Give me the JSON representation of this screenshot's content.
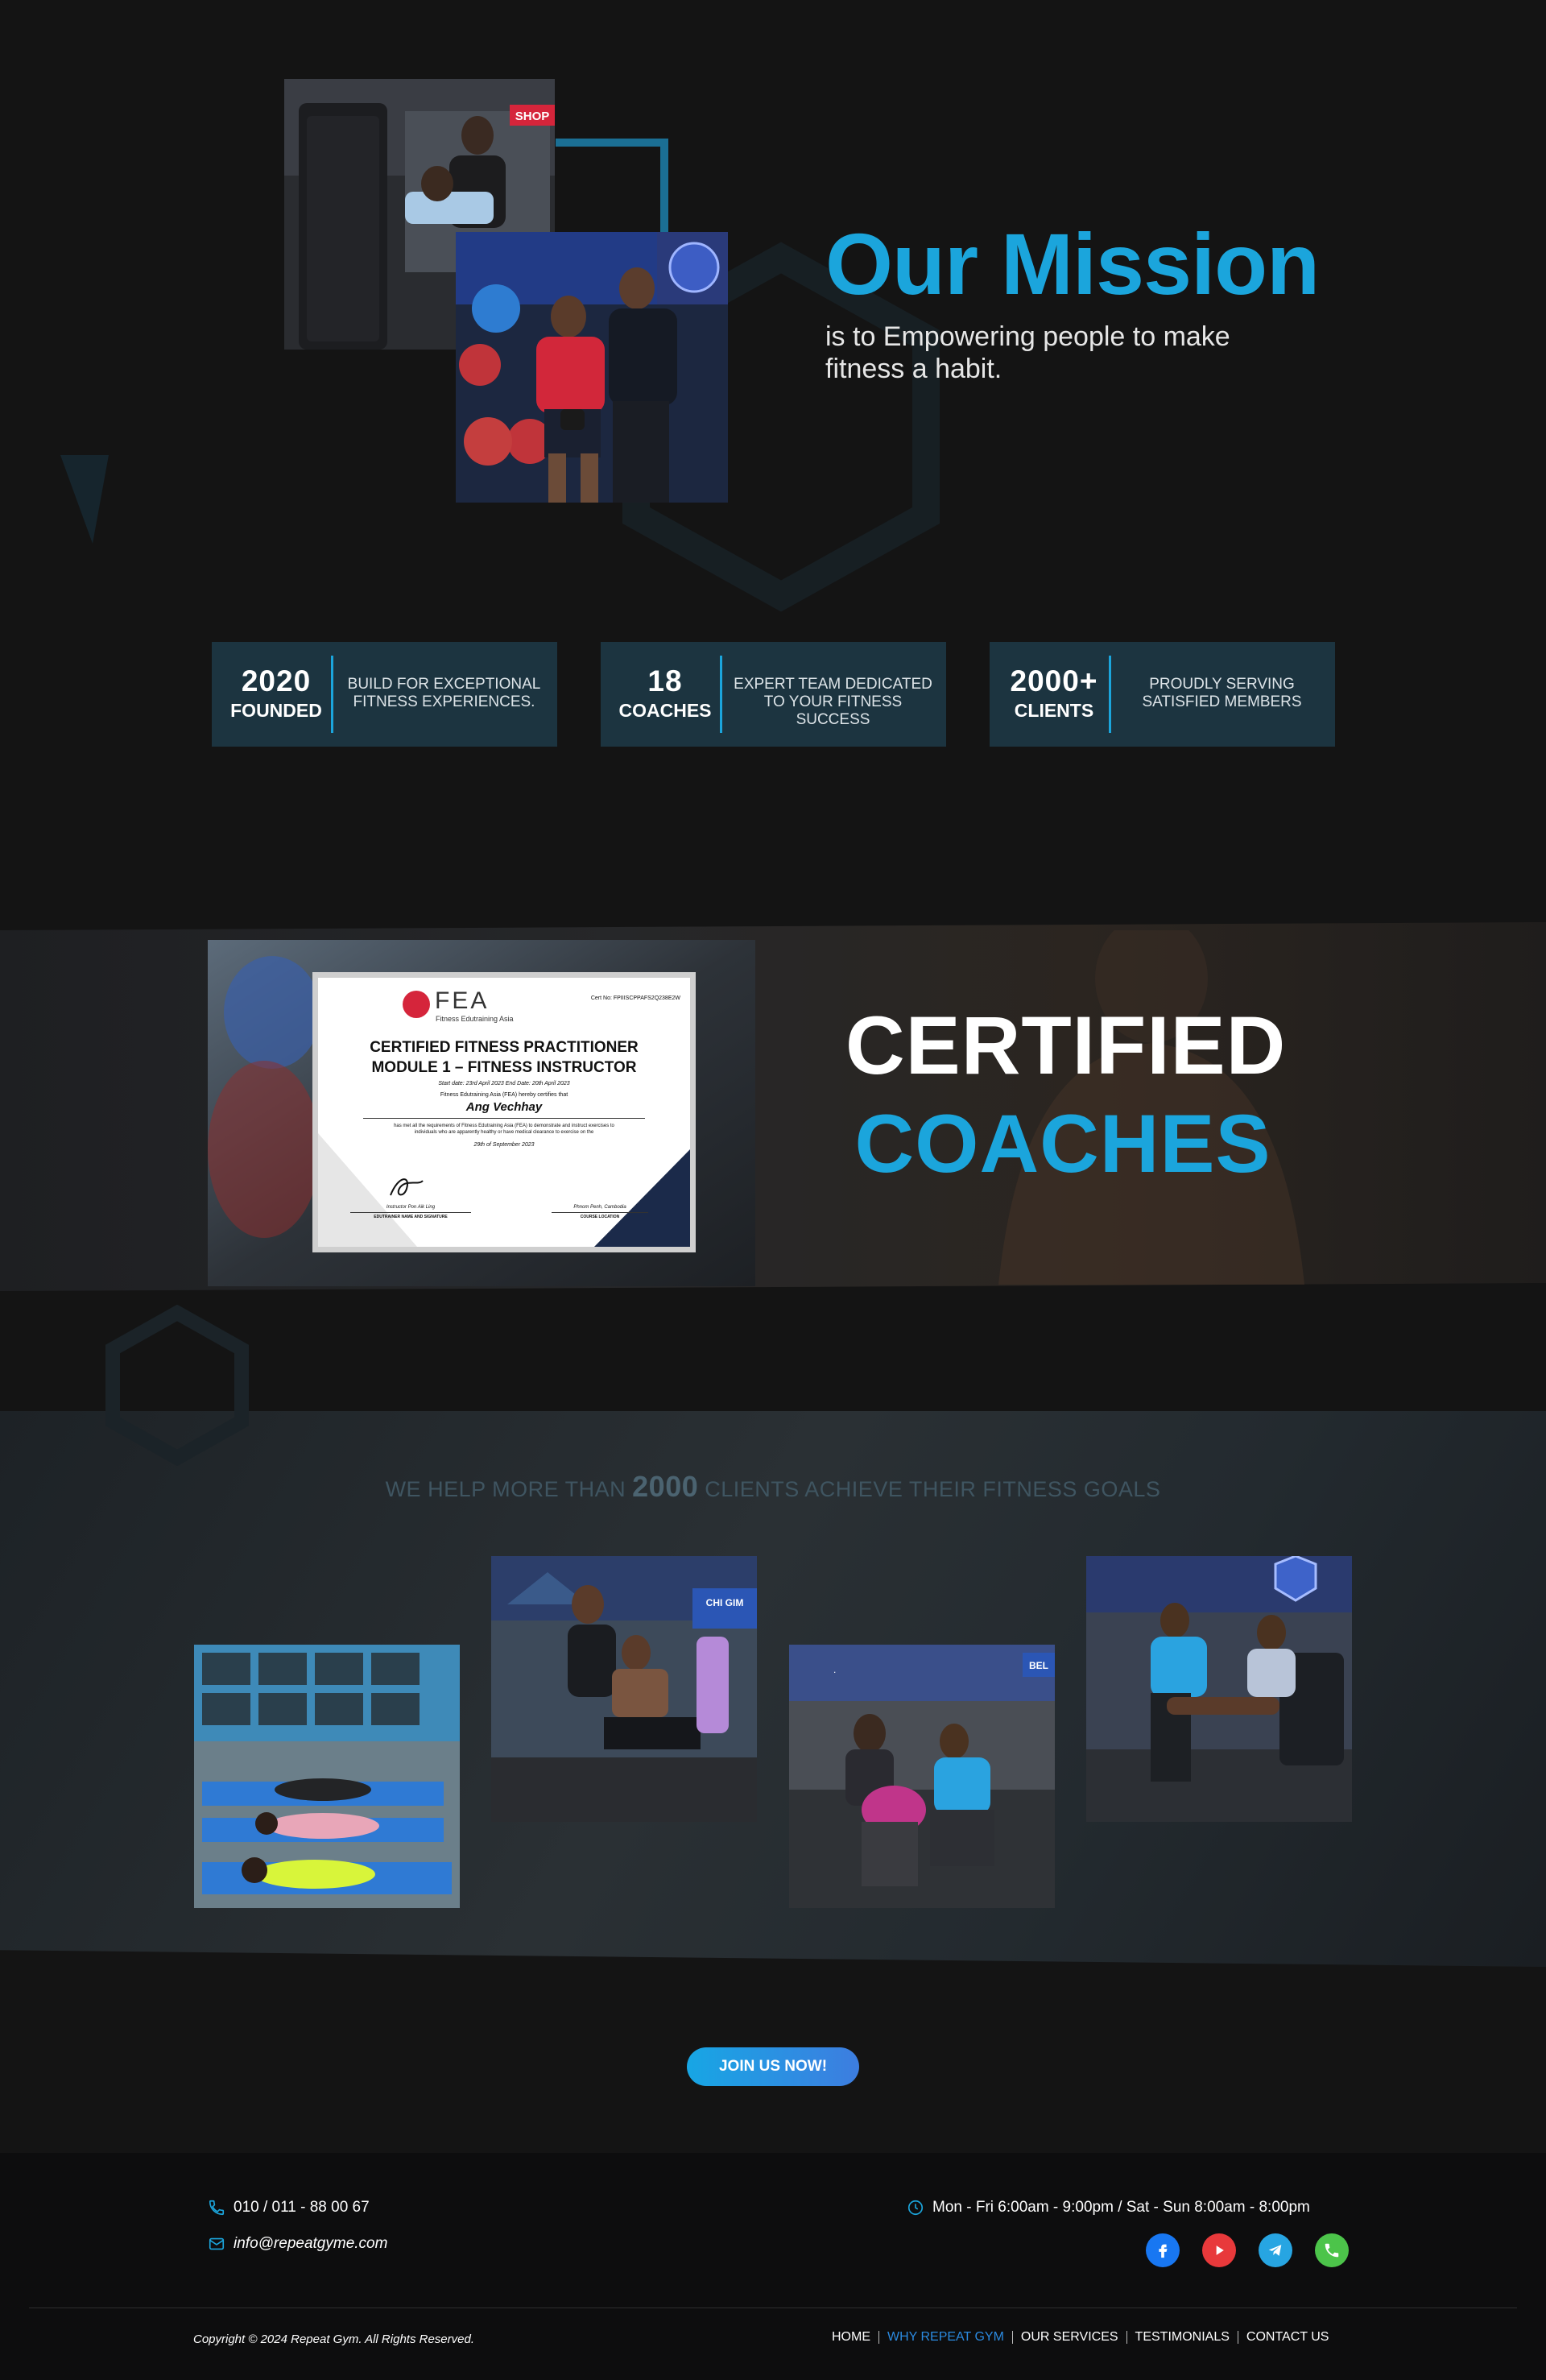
{
  "mission": {
    "title": "Our Mission",
    "subtitle": "is to Empowering people to make fitness a habit."
  },
  "stats": [
    {
      "number": "2020",
      "label": "FOUNDED",
      "description": "Build for exceptional fitness experiences."
    },
    {
      "number": "18",
      "label": "COACHES",
      "description": "Expert team dedicated to your fitness success"
    },
    {
      "number": "2000+",
      "label": "CLIENTS",
      "description": "Proudly serving satisfied members"
    }
  ],
  "certificate": {
    "org": "FEA",
    "org_sub": "Fitness Edutraining Asia",
    "cert_no": "Cert No: FPIIISCPPAFS2Q238E2W",
    "line1": "CERTIFIED FITNESS PRACTITIONER",
    "line2": "MODULE 1 – FITNESS INSTRUCTOR",
    "dates": "Start date: 23rd April 2023 End Date: 20th April 2023",
    "certifies": "Fitness Edutraining Asia (FEA) hereby certifies that",
    "name": "Ang Vechhay",
    "body": "has met all the requirements of Fitness Edutraining Asia (FEA) to demonstrate and instruct exercises to individuals who are apparently healthy or have medical clearance to exercise on the",
    "date": "29th of September 2023",
    "left_sign_name": "Instructor Pon Aik Ling",
    "left_sign_label": "EDUTRAINER NAME AND SIGNATURE",
    "right_sign_name": "Phnom Penh, Cambodia",
    "right_sign_label": "COURSE LOCATION"
  },
  "certified": {
    "line1": "CERTIFIED",
    "line2": "COACHES"
  },
  "clients": {
    "prefix": "WE HELP MORE THAN",
    "number": "2000",
    "suffix": "CLIENTS ACHIEVE THEIR FITNESS GOALS"
  },
  "cta": {
    "label": "JOIN US NOW!"
  },
  "footer": {
    "phone": "010 / 011 - 88 00 67",
    "email": "info@repeatgyme.com",
    "hours": "Mon - Fri 6:00am - 9:00pm / Sat - Sun 8:00am - 8:00pm",
    "copyright": "Copyright © 2024 Repeat Gym. All Rights Reserved.",
    "nav": [
      {
        "label": "HOME",
        "active": false
      },
      {
        "label": "WHY REPEAT GYM",
        "active": true
      },
      {
        "label": "OUR SERVICES",
        "active": false
      },
      {
        "label": "TESTIMONIALS",
        "active": false
      },
      {
        "label": "CONTACT US",
        "active": false
      }
    ],
    "socials": [
      "facebook-icon",
      "youtube-icon",
      "telegram-icon",
      "phone-icon"
    ]
  },
  "photo_labels": {
    "shop_sign": "SHOP",
    "gym_sign_1": "CHI GIM",
    "gym_sign_2": "BEL"
  },
  "colors": {
    "accent": "#1ba5dc",
    "stat_bg": "#1c3440",
    "background": "#141414",
    "footer_bg": "#0d0d0e",
    "nav_active": "#2b8ae0"
  }
}
